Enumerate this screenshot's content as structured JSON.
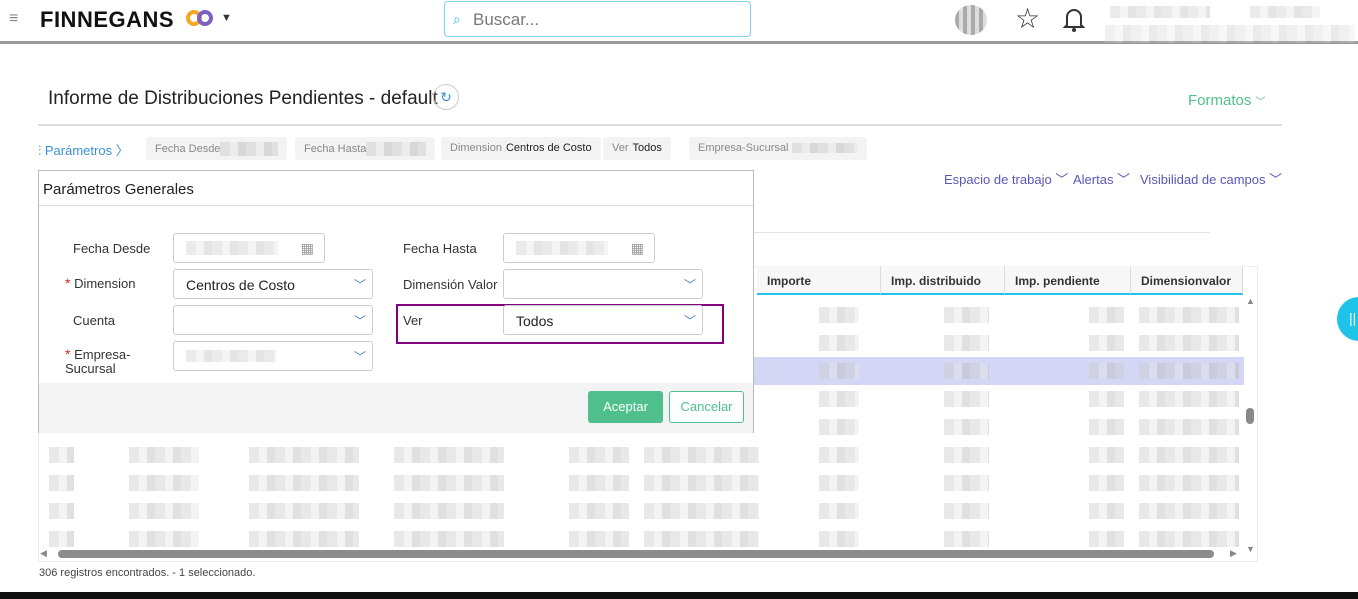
{
  "header": {
    "brand": "FINNEGANS",
    "search_placeholder": "Buscar..."
  },
  "page": {
    "title": "Informe de Distribuciones Pendientes - default",
    "formatos": "Formatos"
  },
  "params_bar": {
    "label": "Parámetros",
    "chips": [
      {
        "label": "Fecha Desde",
        "value": ""
      },
      {
        "label": "Fecha Hasta",
        "value": ""
      },
      {
        "label": "Dimension",
        "value": "Centros de Costo"
      },
      {
        "label": "Ver",
        "value": "Todos"
      },
      {
        "label": "Empresa-Sucursal",
        "value": ""
      }
    ]
  },
  "toolbar": {
    "workspace": "Espacio de trabajo",
    "alerts": "Alertas",
    "visibility": "Visibilidad de campos"
  },
  "dialog": {
    "title": "Parámetros Generales",
    "fecha_desde": "Fecha Desde",
    "fecha_hasta": "Fecha Hasta",
    "dimension": "Dimension",
    "dimension_value": "Centros de Costo",
    "dimension_valor": "Dimensión Valor",
    "cuenta": "Cuenta",
    "ver": "Ver",
    "ver_value": "Todos",
    "empresa": "Empresa-Sucursal",
    "accept": "Aceptar",
    "cancel": "Cancelar"
  },
  "table": {
    "columns": [
      "Importe",
      "Imp. distribuido",
      "Imp. pendiente",
      "Dimensionvalor"
    ]
  },
  "status": "306 registros encontrados. - 1 seleccionado.",
  "colors": {
    "accent": "#4fc08d",
    "link": "#5b57b5",
    "cyan": "#1ec3e8",
    "highlight": "#800080"
  }
}
